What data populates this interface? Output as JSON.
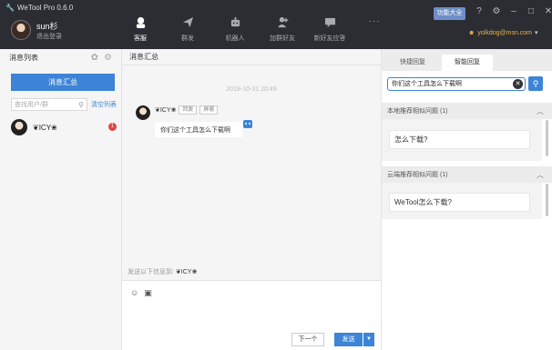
{
  "app": {
    "title": "WeTool Pro 0.6.0"
  },
  "user": {
    "name": "sun杉",
    "logout": "退出登录",
    "email": "yolkdog@msn.com"
  },
  "nav": [
    {
      "label": "客服",
      "icon": "customer-service-icon"
    },
    {
      "label": "群发",
      "icon": "paper-plane-icon"
    },
    {
      "label": "机器人",
      "icon": "robot-icon"
    },
    {
      "label": "加群好友",
      "icon": "add-friend-icon"
    },
    {
      "label": "新好友应答",
      "icon": "chat-reply-icon"
    }
  ],
  "nav_more": "···",
  "toolbar": {
    "func_label": "功能大全"
  },
  "left": {
    "title": "消息列表",
    "summary_button": "消息汇总",
    "search_placeholder": "查找用户/群",
    "clear_label": "清空列表",
    "contacts": [
      {
        "name": "❦ICY❀",
        "badge": "1"
      }
    ]
  },
  "center": {
    "title": "消息汇总",
    "timestamp": "2018-10-31 20:49",
    "message": {
      "sender": "❦ICY❀",
      "reply_label": "回复",
      "block_label": "屏蔽",
      "text": "你们这个工具怎么下载啊"
    },
    "send_to_prefix": "发送以下信息到:",
    "send_to_name": "❦ICY❀",
    "next_button": "下一个",
    "send_button": "发送"
  },
  "right": {
    "tabs": [
      "快捷回复",
      "智能回复"
    ],
    "active_tab": 1,
    "query": "你们这个工具怎么下载啊",
    "sections": [
      {
        "title": "本地推荐相似问题",
        "count": "(1)",
        "answer": "怎么下载?"
      },
      {
        "title": "云端推荐相似问题",
        "count": "(1)",
        "answer": "WeTool怎么下载?"
      }
    ]
  },
  "colors": {
    "accent": "#3d84d6",
    "titlebar": "#2b2d33",
    "email": "#e7b24a",
    "badge": "#e64340"
  }
}
